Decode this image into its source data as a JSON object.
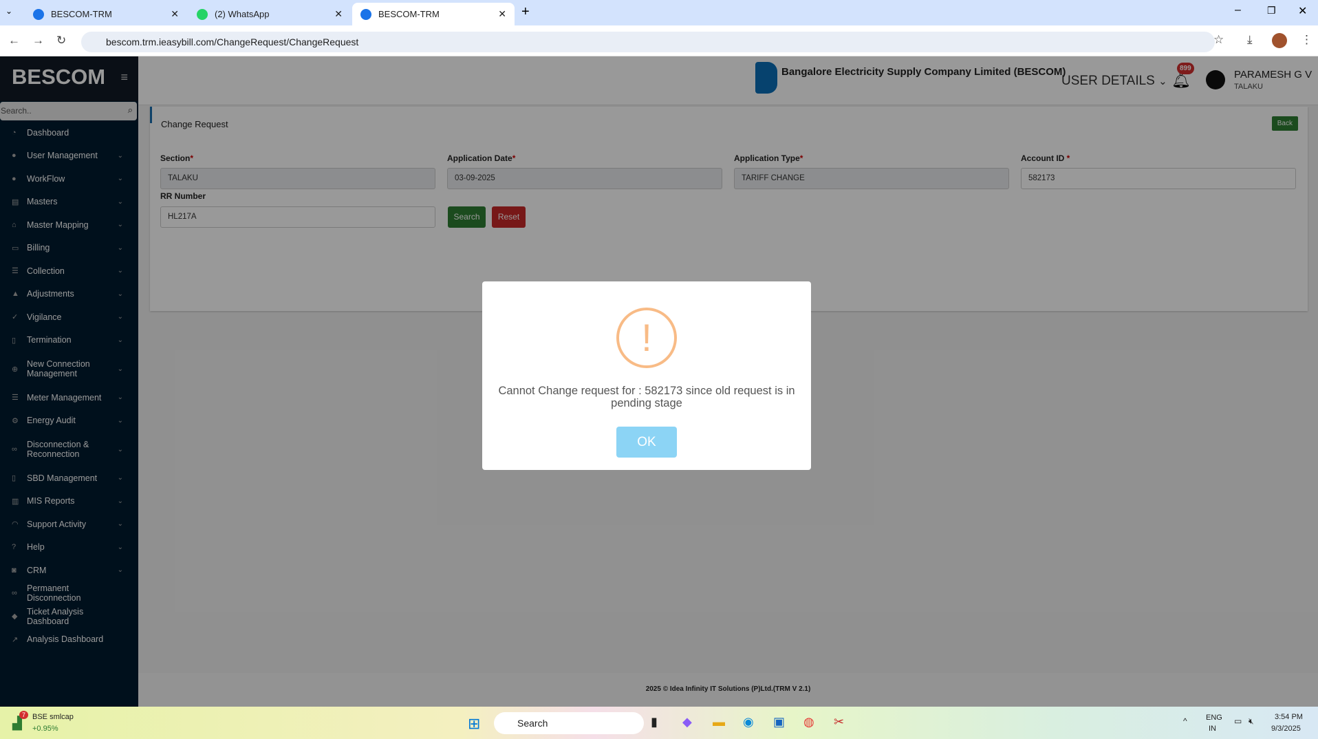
{
  "browser": {
    "tabs": [
      {
        "title": "BESCOM-TRM"
      },
      {
        "title": "(2) WhatsApp"
      },
      {
        "title": "BESCOM-TRM"
      }
    ],
    "url": "bescom.trm.ieasybill.com/ChangeRequest/ChangeRequest"
  },
  "sidebar": {
    "logo": "BESCOM",
    "search_placeholder": "Search..",
    "items": [
      {
        "label": "Dashboard",
        "icon": "dashboard-icon",
        "chev": false
      },
      {
        "label": "User Management",
        "icon": "user-icon",
        "chev": true
      },
      {
        "label": "WorkFlow",
        "icon": "user-icon",
        "chev": true
      },
      {
        "label": "Masters",
        "icon": "card-icon",
        "chev": true
      },
      {
        "label": "Master Mapping",
        "icon": "sitemap-icon",
        "chev": true
      },
      {
        "label": "Billing",
        "icon": "desktop-icon",
        "chev": true
      },
      {
        "label": "Collection",
        "icon": "list-icon",
        "chev": true
      },
      {
        "label": "Adjustments",
        "icon": "road-icon",
        "chev": true
      },
      {
        "label": "Vigilance",
        "icon": "vk-icon",
        "chev": true
      },
      {
        "label": "Termination",
        "icon": "trash-icon",
        "chev": true
      },
      {
        "label": "New Connection Management",
        "icon": "plus-circle-icon",
        "chev": true
      },
      {
        "label": "Meter Management",
        "icon": "list-icon",
        "chev": true
      },
      {
        "label": "Energy Audit",
        "icon": "cogs-icon",
        "chev": true
      },
      {
        "label": "Disconnection & Reconnection",
        "icon": "link-icon",
        "chev": true
      },
      {
        "label": "SBD Management",
        "icon": "mobile-icon",
        "chev": true
      },
      {
        "label": "MIS Reports",
        "icon": "bar-chart-icon",
        "chev": true
      },
      {
        "label": "Support Activity",
        "icon": "headset-icon",
        "chev": true
      },
      {
        "label": "Help",
        "icon": "help-icon",
        "chev": true
      },
      {
        "label": "CRM",
        "icon": "crm-icon",
        "chev": true
      },
      {
        "label": "Permanent Disconnection",
        "icon": "link-icon",
        "chev": false
      },
      {
        "label": "Ticket Analysis Dashboard",
        "icon": "ticket-icon",
        "chev": false
      },
      {
        "label": "Analysis Dashboard",
        "icon": "line-chart-icon",
        "chev": false
      }
    ]
  },
  "header": {
    "company": "Bangalore Electricity Supply Company Limited (BESCOM)",
    "user_details": "USER DETAILS",
    "notifications": "899",
    "user_name": "PARAMESH G V",
    "user_location": "TALAKU"
  },
  "form": {
    "title": "Change Request",
    "back": "Back",
    "section_label": "Section",
    "section_value": "TALAKU",
    "app_date_label": "Application Date",
    "app_date_value": "03-09-2025",
    "app_type_label": "Application Type",
    "app_type_value": "TARIFF CHANGE",
    "account_label": "Account ID ",
    "account_value": "582173",
    "rr_label": "RR Number",
    "rr_value": "HL217A",
    "required": "*",
    "search": "Search",
    "reset": "Reset"
  },
  "footer": "2025 © Idea Infinity IT Solutions (P)Ltd.(TRM V 2.1)",
  "modal": {
    "message": "Cannot Change request for : 582173 since old request is in pending stage",
    "ok": "OK",
    "icon": "!"
  },
  "taskbar": {
    "stock_name": "BSE smlcap",
    "stock_change": "+0.95%",
    "stock_badge": "7",
    "search": "Search",
    "lang": "ENG",
    "region": "IN",
    "time": "3:54 PM",
    "date": "9/3/2025"
  }
}
